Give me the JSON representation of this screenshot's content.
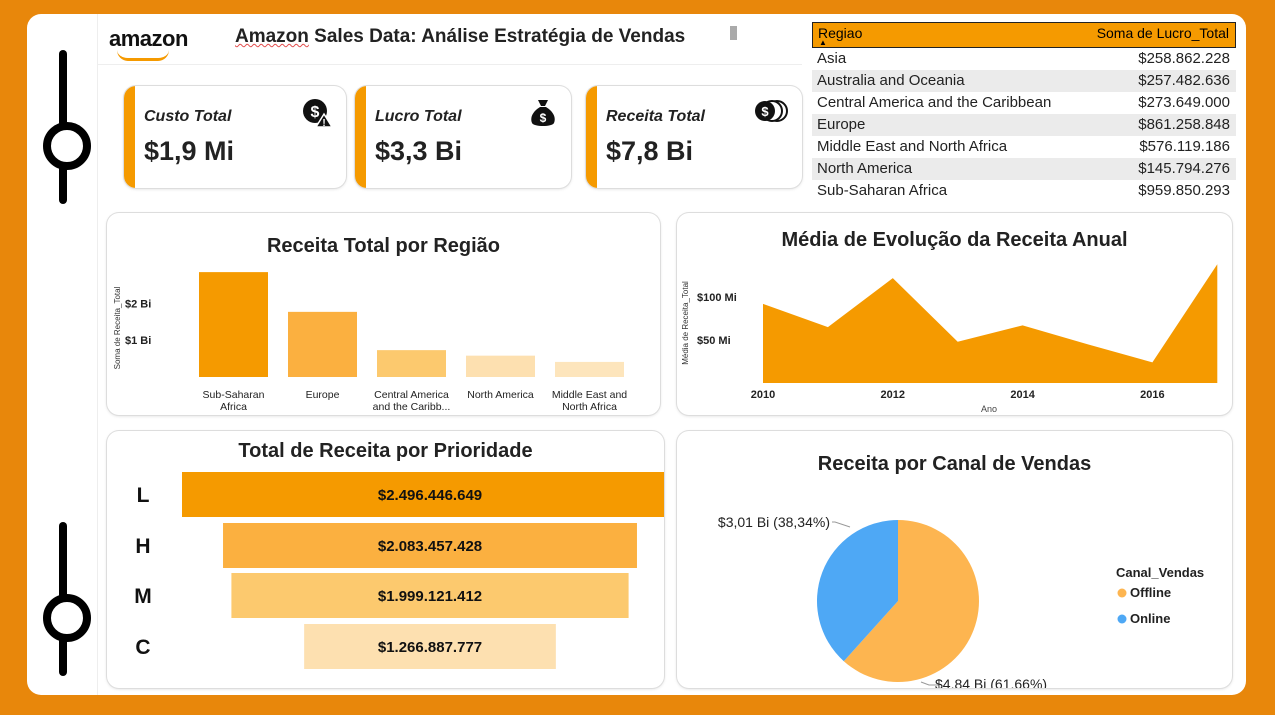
{
  "header": {
    "logo": "amazon",
    "title_underlined": "Amazon",
    "title_rest": " Sales Data: Análise Estratégia de Vendas"
  },
  "kpis": [
    {
      "label": "Custo Total",
      "value": "$1,9 Mi",
      "icon": "dollar-warning-icon"
    },
    {
      "label": "Lucro Total",
      "value": "$3,3 Bi",
      "icon": "money-bag-icon"
    },
    {
      "label": "Receita Total",
      "value": "$7,8 Bi",
      "icon": "coins-icon"
    }
  ],
  "table": {
    "col1": "Regiao",
    "col2": "Soma de Lucro_Total",
    "rows": [
      {
        "region": "Asia",
        "value": "$258.862.228"
      },
      {
        "region": "Australia and Oceania",
        "value": "$257.482.636"
      },
      {
        "region": "Central America and the Caribbean",
        "value": "$273.649.000"
      },
      {
        "region": "Europe",
        "value": "$861.258.848"
      },
      {
        "region": "Middle East and North Africa",
        "value": "$576.119.186"
      },
      {
        "region": "North America",
        "value": "$145.794.276"
      },
      {
        "region": "Sub-Saharan Africa",
        "value": "$959.850.293"
      }
    ]
  },
  "colors": {
    "orange": "#f59a00",
    "orange2": "#fbb040",
    "orange3": "#fcc96e",
    "orange4": "#fde0b0",
    "blue": "#4ea8f5",
    "pie_offline": "#fdb550"
  },
  "chart_data": [
    {
      "type": "bar",
      "title": "Receita Total por Região",
      "ylabel": "Soma de Receita_Total",
      "categories": [
        [
          "Sub-Saharan",
          "Africa"
        ],
        [
          "Europe"
        ],
        [
          "Central America",
          "and the Caribb..."
        ],
        [
          "North America"
        ],
        [
          "Middle East and",
          "North Africa"
        ]
      ],
      "values": [
        2.85,
        1.77,
        0.73,
        0.58,
        0.41
      ],
      "yticks": [
        {
          "v": 1,
          "label": "$1 Bi"
        },
        {
          "v": 2,
          "label": "$2 Bi"
        }
      ],
      "ylim": [
        0,
        3
      ]
    },
    {
      "type": "area",
      "title": "Média de Evolução da Receita Anual",
      "xlabel": "Ano",
      "ylabel": "Média de Receita_Total",
      "x": [
        2010,
        2011,
        2012,
        2013,
        2014,
        2015,
        2016,
        2017
      ],
      "values": [
        92,
        65,
        122,
        48,
        67,
        45,
        24,
        138
      ],
      "xticks": [
        2010,
        2012,
        2014,
        2016
      ],
      "yticks": [
        {
          "v": 50,
          "label": "$50 Mi"
        },
        {
          "v": 100,
          "label": "$100 Mi"
        }
      ],
      "ylim": [
        0,
        140
      ]
    },
    {
      "type": "bar",
      "title": "Total de Receita por Prioridade",
      "categories": [
        "L",
        "H",
        "M",
        "C"
      ],
      "values": [
        2496446649,
        2083457428,
        1999121412,
        1266887777
      ],
      "labels": [
        "$2.496.446.649",
        "$2.083.457.428",
        "$1.999.121.412",
        "$1.266.887.777"
      ]
    },
    {
      "type": "pie",
      "title": "Receita por Canal de Vendas",
      "legend_title": "Canal_Vendas",
      "slices": [
        {
          "name": "Offline",
          "value": 61.66,
          "label": "$4,84 Bi (61,66%)"
        },
        {
          "name": "Online",
          "value": 38.34,
          "label": "$3,01 Bi (38,34%)"
        }
      ]
    }
  ]
}
